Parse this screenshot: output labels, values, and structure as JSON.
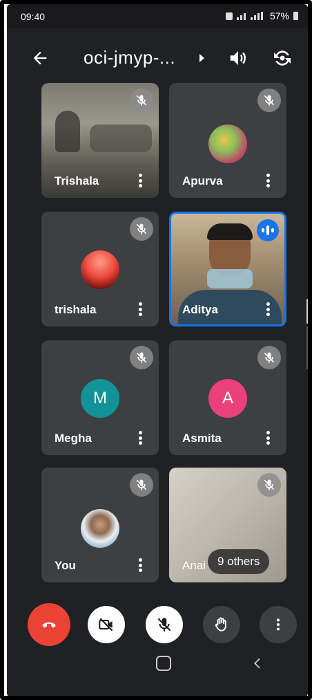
{
  "status_bar": {
    "time": "09:40",
    "battery": "57%"
  },
  "call": {
    "title": "oci-jmyp-..."
  },
  "participants": [
    {
      "name": "Trishala",
      "type": "video",
      "muted": true
    },
    {
      "name": "Apurva",
      "type": "photo-avatar",
      "muted": true
    },
    {
      "name": "trishala",
      "type": "photo-avatar",
      "muted": true
    },
    {
      "name": "Aditya",
      "type": "video",
      "speaking": true
    },
    {
      "name": "Megha",
      "type": "letter-avatar",
      "letter": "M",
      "color": "#12939a",
      "muted": true
    },
    {
      "name": "Asmita",
      "type": "letter-avatar",
      "letter": "A",
      "color": "#ec407a",
      "muted": true
    },
    {
      "name": "You",
      "type": "photo-avatar",
      "muted": true
    },
    {
      "name": "Anai",
      "type": "video",
      "muted": true
    }
  ],
  "others_chip": "9 others",
  "controls": {
    "end_call_color": "#ea4335"
  }
}
